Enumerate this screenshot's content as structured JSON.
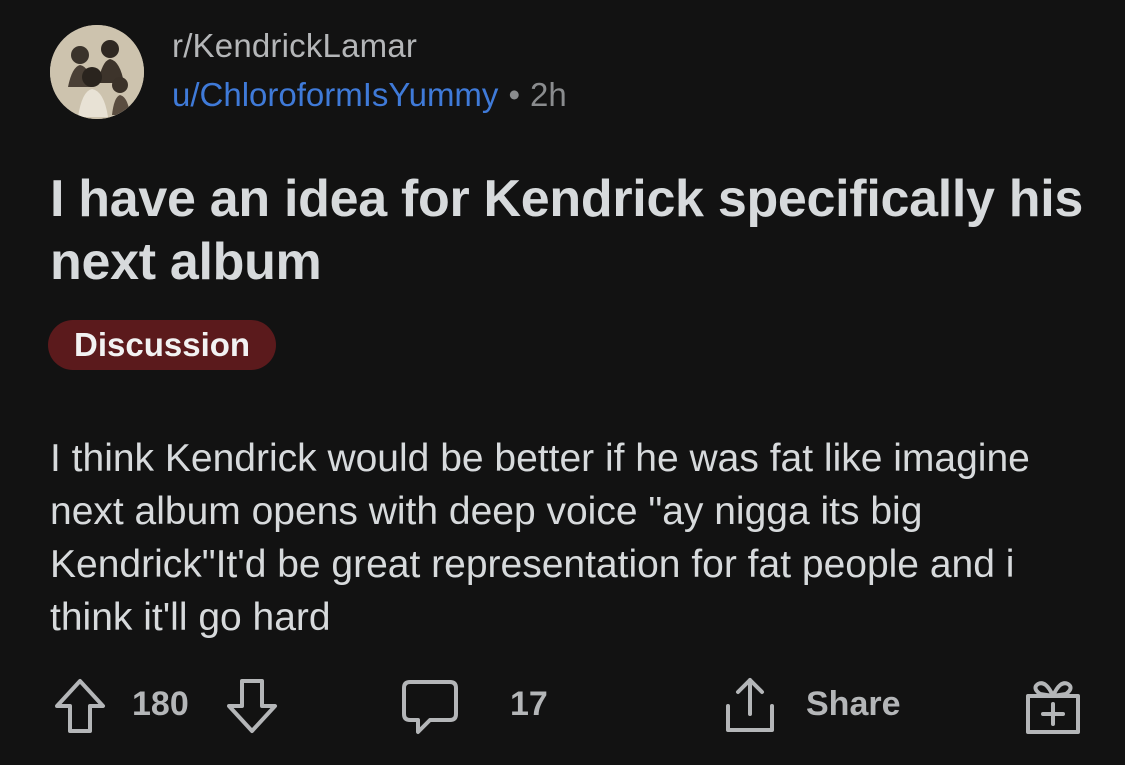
{
  "post": {
    "subreddit": "r/KendrickLamar",
    "username": "u/ChloroformIsYummy",
    "separator": "•",
    "age": "2h",
    "title": "I have an idea for Kendrick specifically his next album",
    "flair": "Discussion",
    "body": "I think Kendrick would be better if he was fat like imagine next album opens with deep voice \"ay nigga its big Kendrick\"It'd be great representation for fat people and i think it'll go hard"
  },
  "actions": {
    "upvote_icon": "arrow-up-icon",
    "vote_count": "180",
    "downvote_icon": "arrow-down-icon",
    "comment_icon": "comment-bubble-icon",
    "comment_count": "17",
    "share_icon": "share-icon",
    "share_label": "Share",
    "award_icon": "gift-award-icon"
  },
  "colors": {
    "background": "#121212",
    "text": "#d7dadc",
    "muted": "#8a8c8e",
    "username": "#3f7ad8",
    "flair_bg": "#5b1a1c"
  }
}
